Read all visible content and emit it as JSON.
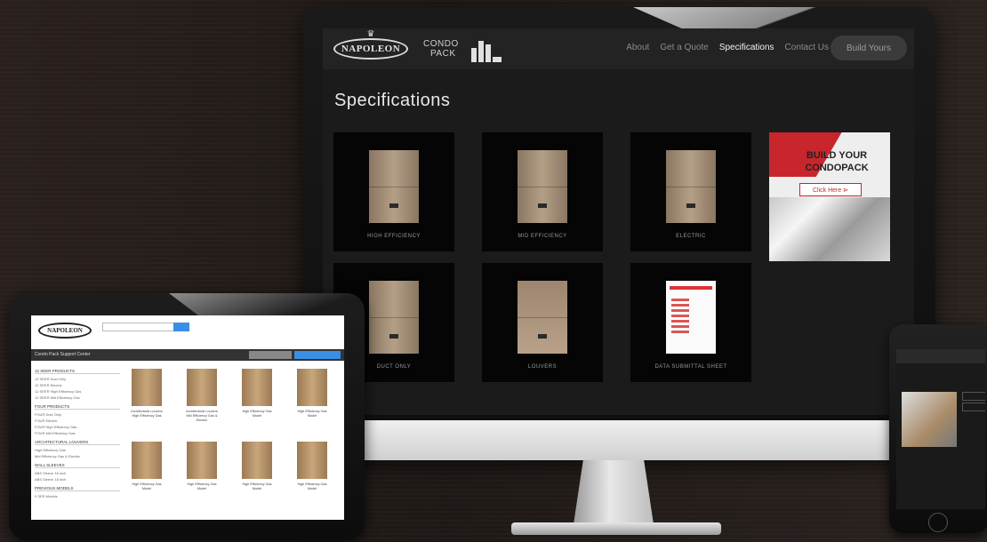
{
  "desktop": {
    "brand": "NAPOLEON",
    "brand2": {
      "line1": "CONDO",
      "line2": "PACK"
    },
    "nav": [
      "About",
      "Get a Quote",
      "Specifications",
      "Contact Us"
    ],
    "nav_active": "Specifications",
    "nav_button": "Build Yours",
    "page_title": "Specifications",
    "cards": [
      "HIGH EFFICIENCY",
      "MID EFFICIENCY",
      "ELECTRIC",
      "DUCT ONLY",
      "LOUVERS",
      "DATA SUBMITTAL SHEET"
    ],
    "promo": {
      "line1": "BUILD YOUR",
      "line2": "CONDOPACK",
      "button": "Click Here  ⊳"
    }
  },
  "tablet": {
    "brand": "NAPOLEON",
    "bar_title": "Condo Pack Support Center",
    "sidebar": [
      {
        "heading": "12 SEER PRODUCTS",
        "items": [
          "12 SEER Duct Only",
          "12 SEER Electric",
          "12 SEER High Efficiency Gas",
          "12 SEER Mid Efficiency Gas"
        ]
      },
      {
        "heading": "FOUR PRODUCTS",
        "items": [
          "FOUR Duct Only",
          "FOUR Electric",
          "FOUR High Efficiency Gas",
          "FOUR Mid Efficiency Gas"
        ]
      },
      {
        "heading": "ARCHITECTURAL LOUVERS",
        "items": [
          "High Efficiency Gas",
          "Mid Efficiency Gas & Electric"
        ]
      },
      {
        "heading": "WALL SLEEVES",
        "items": [
          "ABS Sleeve 16 inch",
          "ABS Sleeve 18 inch"
        ]
      },
      {
        "heading": "PREVIOUS MODELS",
        "items": [
          "9 SER Models"
        ]
      }
    ],
    "products": [
      "Architectural Louvers High Efficiency Gas",
      "Architectural Louvers Mid Efficiency Gas & Electric",
      "High Efficiency Gas Model",
      "High Efficiency Gas Model",
      "High Efficiency Gas Model",
      "High Efficiency Gas Model",
      "High Efficiency Gas Model",
      "High Efficiency Gas Model"
    ]
  },
  "colors": {
    "background": "#211a17",
    "screen": "#1b1b1b",
    "accent_red": "#c8262c",
    "tablet_accent": "#3a8ee6"
  }
}
